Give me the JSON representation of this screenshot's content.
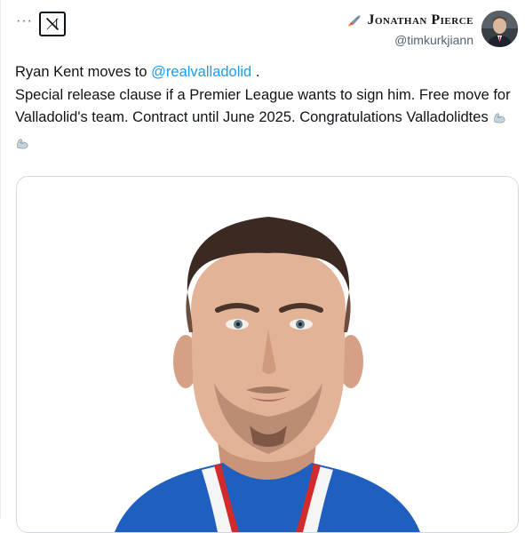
{
  "header": {
    "more_label": "···",
    "logo_icon": "x-logo-icon"
  },
  "author": {
    "name": "Jonathan Pierce",
    "handle": "@timkurkjiann",
    "badge_icon": "rocket-icon",
    "avatar_icon": "avatar-photo"
  },
  "tweet": {
    "line1_prefix": "Ryan Kent moves to ",
    "mention": "@realvalladolid",
    "line1_suffix": " .",
    "body": "Special release clause if a Premier League wants to sign him. Free move for Valladolid's team. Contract until June 2025. Congratulations Valladolidtes",
    "emoji_icons": [
      "flexed-biceps-icon",
      "flexed-biceps-icon"
    ]
  },
  "media": {
    "type": "photo",
    "subject": "player-portrait"
  },
  "colors": {
    "mention": "#1d9bf0",
    "text": "#0f1419",
    "secondary": "#536471",
    "border": "#cfd9de",
    "jersey_blue": "#1f5fbf",
    "jersey_red": "#d22b2b"
  }
}
